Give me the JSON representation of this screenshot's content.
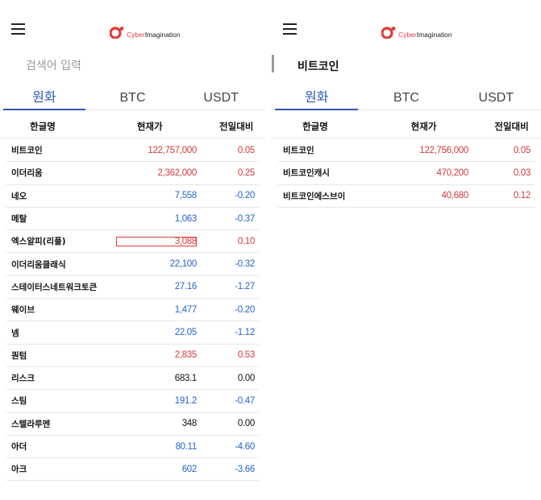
{
  "logo": {
    "prefix": "Cyber",
    "suffix": "Imagination"
  },
  "tabs": [
    "원화",
    "BTC",
    "USDT"
  ],
  "columns": {
    "name": "한글명",
    "price": "현재가",
    "change": "전일대비"
  },
  "left": {
    "search_placeholder": "검색어 입력",
    "active_tab": "원화",
    "rows": [
      {
        "name": "비트코인",
        "price": "122,757,000",
        "change": "0.05",
        "dir": "up"
      },
      {
        "name": "이더리움",
        "price": "2,362,000",
        "change": "0.25",
        "dir": "up"
      },
      {
        "name": "네오",
        "price": "7,558",
        "change": "-0.20",
        "dir": "down"
      },
      {
        "name": "메탈",
        "price": "1,063",
        "change": "-0.37",
        "dir": "down"
      },
      {
        "name": "엑스알피(리플)",
        "price": "3,088",
        "change": "0.10",
        "dir": "up",
        "highlight": true
      },
      {
        "name": "이더리움클래식",
        "price": "22,100",
        "change": "-0.32",
        "dir": "down"
      },
      {
        "name": "스테이터스네트워크토큰",
        "price": "27.16",
        "change": "-1.27",
        "dir": "down"
      },
      {
        "name": "웨이브",
        "price": "1,477",
        "change": "-0.20",
        "dir": "down"
      },
      {
        "name": "넴",
        "price": "22.05",
        "change": "-1.12",
        "dir": "down"
      },
      {
        "name": "퀀텀",
        "price": "2,835",
        "change": "0.53",
        "dir": "up"
      },
      {
        "name": "리스크",
        "price": "683.1",
        "change": "0.00",
        "dir": "flat"
      },
      {
        "name": "스팀",
        "price": "191.2",
        "change": "-0.47",
        "dir": "down"
      },
      {
        "name": "스텔라루멘",
        "price": "348",
        "change": "0.00",
        "dir": "flat"
      },
      {
        "name": "아더",
        "price": "80.11",
        "change": "-4.60",
        "dir": "down"
      },
      {
        "name": "아크",
        "price": "602",
        "change": "-3.66",
        "dir": "down"
      }
    ]
  },
  "right": {
    "search_value": "비트코인",
    "active_tab": "원화",
    "rows": [
      {
        "name": "비트코인",
        "price": "122,756,000",
        "change": "0.05",
        "dir": "up"
      },
      {
        "name": "비트코인캐시",
        "price": "470,200",
        "change": "0.03",
        "dir": "up"
      },
      {
        "name": "비트코인에스브이",
        "price": "40,680",
        "change": "0.12",
        "dir": "up"
      }
    ]
  }
}
